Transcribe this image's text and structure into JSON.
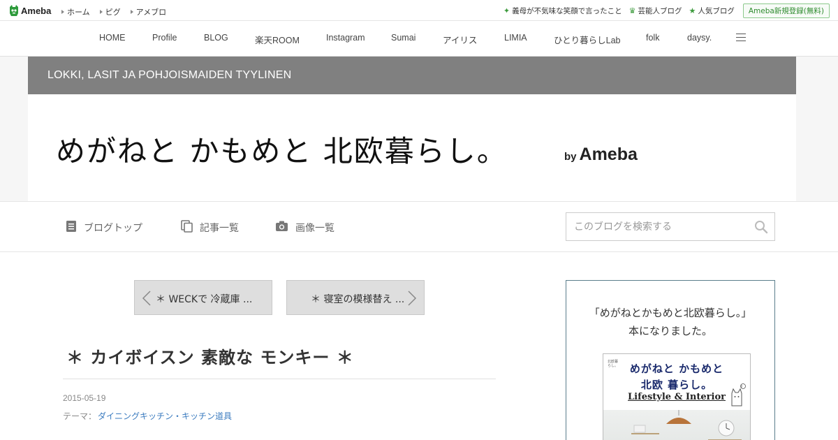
{
  "topbar": {
    "logo_text": "Ameba",
    "nav": [
      "ホーム",
      "ピグ",
      "アメブロ"
    ],
    "right_links": [
      {
        "icon": "sparkle-icon",
        "label": "義母が不気味な笑顔で言ったこと"
      },
      {
        "icon": "crown-icon",
        "label": "芸能人ブログ"
      },
      {
        "icon": "star-icon",
        "label": "人気ブログ"
      }
    ],
    "register_label": "Ameba新規登録(無料)"
  },
  "blognav": {
    "items": [
      "HOME",
      "Profile",
      "BLOG",
      "楽天ROOM",
      "Instagram",
      "Sumai",
      "アイリス",
      "LIMIA",
      "ひとり暮らしLab",
      "folk",
      "daysy."
    ],
    "menu_icon": "hamburger-icon"
  },
  "header": {
    "bar_title": "LOKKI, LASIT JA POHJOISMAIDEN TYYLINEN",
    "blog_title": "めがねと かもめと 北欧暮らし。",
    "by": "by",
    "ameba": "Ameba"
  },
  "tools": {
    "blog_top": "ブログトップ",
    "article_list": "記事一覧",
    "image_list": "画像一覧",
    "search_placeholder": "このブログを検索する"
  },
  "article": {
    "prev_label": "＊ WECKで 冷蔵庫 ...",
    "next_label": "＊ 寝室の模様替え ...",
    "title": "＊ カイボイスン 素敵な モンキー ＊",
    "date": "2015-05-19",
    "theme_prefix": "テーマ：",
    "theme": "ダイニングキッチン・キッチン道具"
  },
  "side": {
    "line1": "「めがねとかもめと北欧暮らし。」",
    "line2": "本になりました。",
    "book_title1": "めがねと かもめと",
    "book_title2": "北欧 暮らし。",
    "book_title3": "Lifestyle & Interior",
    "book_tiny1": "北欧暮",
    "book_tiny2": "らし。"
  },
  "colors": {
    "accent_green": "#3c9a3c",
    "header_bar": "#808080",
    "link_blue": "#3b7bbf",
    "side_border": "#5b7e8c"
  }
}
